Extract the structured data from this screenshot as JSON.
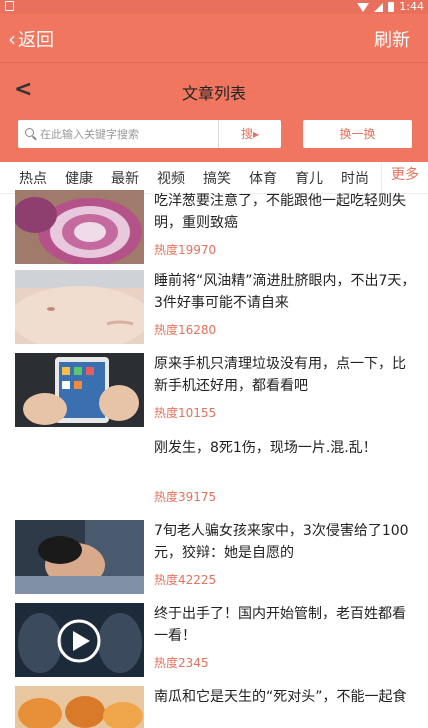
{
  "status_bar": {
    "time": "1:44"
  },
  "app_bar": {
    "back_label": "返回",
    "refresh_label": "刷新"
  },
  "title_bar": {
    "title": "文章列表"
  },
  "search": {
    "placeholder": "在此输入关键字搜索",
    "button_label": "搜▸",
    "swap_label": "换一换"
  },
  "tabs": {
    "items": [
      "热点",
      "健康",
      "最新",
      "视频",
      "搞笑",
      "体育",
      "育儿",
      "时尚"
    ],
    "more_label": "更多"
  },
  "articles": [
    {
      "title": "吃洋葱要注意了，不能跟他一起吃轻则失明，重则致癌",
      "heat": "热度19970",
      "image": "onion-photo"
    },
    {
      "title": "睡前将“风油精”滴进肚脐眼内，不出7天，3件好事可能不请自来",
      "heat": "热度16280",
      "image": "belly-photo"
    },
    {
      "title": "原来手机只清理垃圾没有用，点一下，比新手机还好用，都看看吧",
      "heat": "热度10155",
      "image": "phone-photo"
    },
    {
      "title": "刚发生，8死1伤，现场一片.混.乱！",
      "heat": "热度39175",
      "image": ""
    },
    {
      "title": "7旬老人骗女孩来家中，3次侵害给了100元，狡辩：她是自愿的",
      "heat": "热度42225",
      "image": "girl-photo"
    },
    {
      "title": "终于出手了！国内开始管制，老百姓都看一看！",
      "heat": "热度2345",
      "image": "video-photo"
    },
    {
      "title": "南瓜和它是天生的“死对头”，不能一起食",
      "heat": "",
      "image": "pumpkin-photo"
    }
  ]
}
